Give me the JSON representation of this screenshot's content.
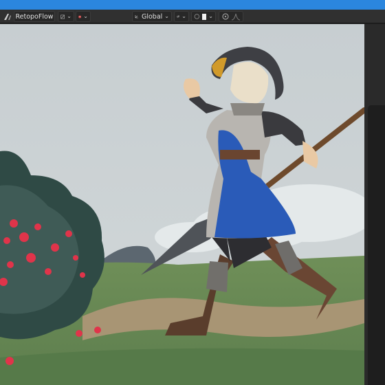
{
  "header": {
    "addon_name": "RetopoFlow",
    "transform_orientation": "Global"
  },
  "icons": {
    "editor": "blender-editor-icon",
    "tool": "draw-tool-icon",
    "theme": "retopoflow-logo-icon",
    "orientation": "transform-orientation-icon",
    "snap": "snap-link-icon",
    "proportional": "proportional-editing-icon",
    "falloff": "falloff-curve-icon"
  },
  "colors": {
    "title_bar": "#2b86de",
    "header_bg": "#303030",
    "sky": "#cdd4d6",
    "dress": "#2a5bb8"
  }
}
